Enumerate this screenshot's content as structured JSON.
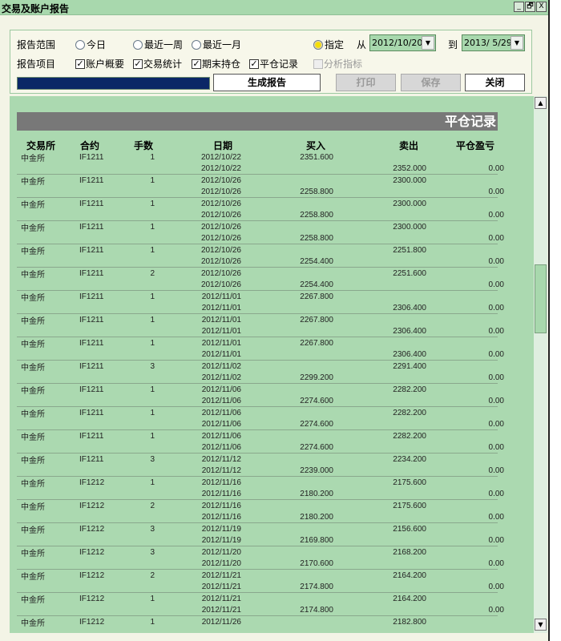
{
  "window": {
    "title": "交易及账户报告",
    "minimize": "_",
    "restore": "🗗",
    "close": "X"
  },
  "panel": {
    "range_label": "报告范围",
    "range_options": [
      {
        "label": "今日",
        "selected": false
      },
      {
        "label": "最近一周",
        "selected": false
      },
      {
        "label": "最近一月",
        "selected": false
      },
      {
        "label": "指定",
        "selected": true
      }
    ],
    "from_label": "从",
    "from_date": "2012/10/20",
    "to_label": "到",
    "to_date": "2013/ 5/29",
    "items_label": "报告项目",
    "items": [
      {
        "label": "账户概要",
        "checked": true,
        "enabled": true
      },
      {
        "label": "交易统计",
        "checked": true,
        "enabled": true
      },
      {
        "label": "期末持仓",
        "checked": true,
        "enabled": true
      },
      {
        "label": "平仓记录",
        "checked": true,
        "enabled": true
      },
      {
        "label": "分析指标",
        "checked": false,
        "enabled": false
      }
    ],
    "progress": 1.0,
    "generate": "生成报告",
    "print": "打印",
    "save": "保存",
    "close": "关闭"
  },
  "report": {
    "section_title": "平仓记录",
    "headers": [
      "交易所",
      "合约",
      "手数",
      "日期",
      "买入",
      "卖出",
      "平仓盈亏"
    ],
    "records": [
      {
        "ex": "中金所",
        "c": "IF1211",
        "n": "1",
        "l1": [
          "2012/10/22",
          "2351.600",
          "",
          ""
        ],
        "l2": [
          "2012/10/22",
          "",
          "2352.000",
          "0.00"
        ]
      },
      {
        "ex": "中金所",
        "c": "IF1211",
        "n": "1",
        "l1": [
          "2012/10/26",
          "",
          "2300.000",
          ""
        ],
        "l2": [
          "2012/10/26",
          "2258.800",
          "",
          "0.00"
        ]
      },
      {
        "ex": "中金所",
        "c": "IF1211",
        "n": "1",
        "l1": [
          "2012/10/26",
          "",
          "2300.000",
          ""
        ],
        "l2": [
          "2012/10/26",
          "2258.800",
          "",
          "0.00"
        ]
      },
      {
        "ex": "中金所",
        "c": "IF1211",
        "n": "1",
        "l1": [
          "2012/10/26",
          "",
          "2300.000",
          ""
        ],
        "l2": [
          "2012/10/26",
          "2258.800",
          "",
          "0.00"
        ]
      },
      {
        "ex": "中金所",
        "c": "IF1211",
        "n": "1",
        "l1": [
          "2012/10/26",
          "",
          "2251.800",
          ""
        ],
        "l2": [
          "2012/10/26",
          "2254.400",
          "",
          "0.00"
        ]
      },
      {
        "ex": "中金所",
        "c": "IF1211",
        "n": "2",
        "l1": [
          "2012/10/26",
          "",
          "2251.600",
          ""
        ],
        "l2": [
          "2012/10/26",
          "2254.400",
          "",
          "0.00"
        ]
      },
      {
        "ex": "中金所",
        "c": "IF1211",
        "n": "1",
        "l1": [
          "2012/11/01",
          "2267.800",
          "",
          ""
        ],
        "l2": [
          "2012/11/01",
          "",
          "2306.400",
          "0.00"
        ]
      },
      {
        "ex": "中金所",
        "c": "IF1211",
        "n": "1",
        "l1": [
          "2012/11/01",
          "2267.800",
          "",
          ""
        ],
        "l2": [
          "2012/11/01",
          "",
          "2306.400",
          "0.00"
        ]
      },
      {
        "ex": "中金所",
        "c": "IF1211",
        "n": "1",
        "l1": [
          "2012/11/01",
          "2267.800",
          "",
          ""
        ],
        "l2": [
          "2012/11/01",
          "",
          "2306.400",
          "0.00"
        ]
      },
      {
        "ex": "中金所",
        "c": "IF1211",
        "n": "3",
        "l1": [
          "2012/11/02",
          "",
          "2291.400",
          ""
        ],
        "l2": [
          "2012/11/02",
          "2299.200",
          "",
          "0.00"
        ]
      },
      {
        "ex": "中金所",
        "c": "IF1211",
        "n": "1",
        "l1": [
          "2012/11/06",
          "",
          "2282.200",
          ""
        ],
        "l2": [
          "2012/11/06",
          "2274.600",
          "",
          "0.00"
        ]
      },
      {
        "ex": "中金所",
        "c": "IF1211",
        "n": "1",
        "l1": [
          "2012/11/06",
          "",
          "2282.200",
          ""
        ],
        "l2": [
          "2012/11/06",
          "2274.600",
          "",
          "0.00"
        ]
      },
      {
        "ex": "中金所",
        "c": "IF1211",
        "n": "1",
        "l1": [
          "2012/11/06",
          "",
          "2282.200",
          ""
        ],
        "l2": [
          "2012/11/06",
          "2274.600",
          "",
          "0.00"
        ]
      },
      {
        "ex": "中金所",
        "c": "IF1211",
        "n": "3",
        "l1": [
          "2012/11/12",
          "",
          "2234.200",
          ""
        ],
        "l2": [
          "2012/11/12",
          "2239.000",
          "",
          "0.00"
        ]
      },
      {
        "ex": "中金所",
        "c": "IF1212",
        "n": "1",
        "l1": [
          "2012/11/16",
          "",
          "2175.600",
          ""
        ],
        "l2": [
          "2012/11/16",
          "2180.200",
          "",
          "0.00"
        ]
      },
      {
        "ex": "中金所",
        "c": "IF1212",
        "n": "2",
        "l1": [
          "2012/11/16",
          "",
          "2175.600",
          ""
        ],
        "l2": [
          "2012/11/16",
          "2180.200",
          "",
          "0.00"
        ]
      },
      {
        "ex": "中金所",
        "c": "IF1212",
        "n": "3",
        "l1": [
          "2012/11/19",
          "",
          "2156.600",
          ""
        ],
        "l2": [
          "2012/11/19",
          "2169.800",
          "",
          "0.00"
        ]
      },
      {
        "ex": "中金所",
        "c": "IF1212",
        "n": "3",
        "l1": [
          "2012/11/20",
          "",
          "2168.200",
          ""
        ],
        "l2": [
          "2012/11/20",
          "2170.600",
          "",
          "0.00"
        ]
      },
      {
        "ex": "中金所",
        "c": "IF1212",
        "n": "2",
        "l1": [
          "2012/11/21",
          "",
          "2164.200",
          ""
        ],
        "l2": [
          "2012/11/21",
          "2174.800",
          "",
          "0.00"
        ]
      },
      {
        "ex": "中金所",
        "c": "IF1212",
        "n": "1",
        "l1": [
          "2012/11/21",
          "",
          "2164.200",
          ""
        ],
        "l2": [
          "2012/11/21",
          "2174.800",
          "",
          "0.00"
        ]
      },
      {
        "ex": "中金所",
        "c": "IF1212",
        "n": "1",
        "l1": [
          "2012/11/26",
          "",
          "2182.800",
          ""
        ],
        "l2": [
          "",
          "",
          "",
          ""
        ]
      }
    ]
  },
  "scrollbar": {
    "up": "▲",
    "down": "▼",
    "position": 0.45
  }
}
